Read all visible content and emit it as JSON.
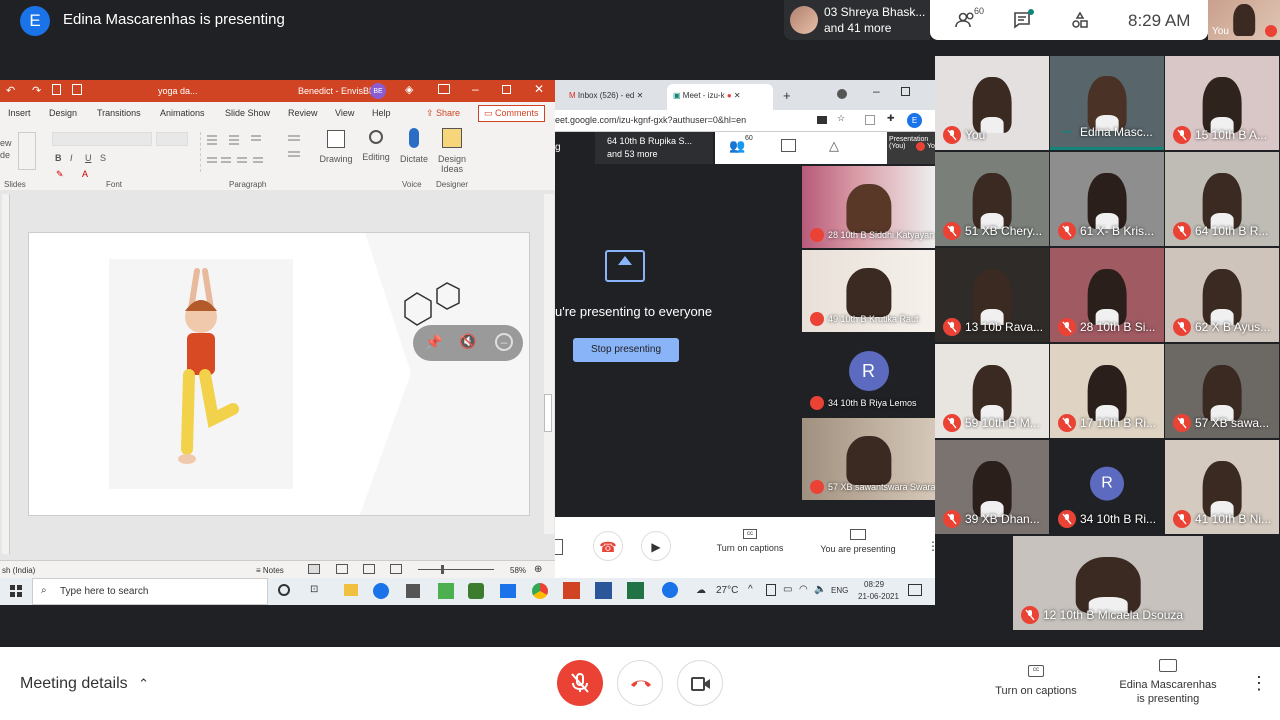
{
  "topbar": {
    "avatar_letter": "E",
    "presenting_title": "Edina Mascarenhas is presenting",
    "people_line1": "03 Shreya Bhask...",
    "people_line2": "and 41 more",
    "people_count": "60",
    "time": "8:29 AM",
    "you_label": "You"
  },
  "ppt": {
    "file_title": "yoga da...",
    "user": "Benedict - EnvisBE",
    "user_initials": "BE",
    "tabs": [
      "Insert",
      "Design",
      "Transitions",
      "Animations",
      "Slide Show",
      "Review",
      "View",
      "Help"
    ],
    "share": "Share",
    "comments": "Comments",
    "groups": [
      "Slides",
      "Font",
      "Paragraph",
      "Voice",
      "Designer"
    ],
    "buttons": {
      "drawing": "Drawing",
      "editing": "Editing",
      "dictate": "Dictate",
      "design_ideas_1": "Design",
      "design_ideas_2": "Ideas",
      "new_label": "ew",
      "de_label": "de"
    },
    "status_lang": "sh (India)",
    "notes": "Notes",
    "zoom": "58%"
  },
  "chrome": {
    "tab1": "Inbox (526) - ed",
    "tab2": "Meet - izu-k",
    "url": "eet.google.com/izu-kgnf-gxk?authuser=0&hl=en",
    "profile": "E"
  },
  "inner_meet": {
    "chip_line1": "64 10th B Rupika S...",
    "chip_line2": "and 53 more",
    "count": "60",
    "presentation_label": "Presentation",
    "presentation_you": "(You)",
    "you_short": "Yo",
    "presenting_to": "u're presenting to everyone",
    "stop": "Stop presenting",
    "captions": "Turn on captions",
    "you_presenting": "You are presenting",
    "tiles": [
      {
        "name": "28 10th B Siddhi Katyayan"
      },
      {
        "name": "49 10th B Krutika Raut"
      },
      {
        "name": "34 10th B Riya Lemos",
        "letter": "R"
      },
      {
        "name": "57 XB sawantswara Swara"
      }
    ]
  },
  "taskbar": {
    "search": "Type here to search",
    "temp": "27°C",
    "lang": "ENG",
    "time": "08:29",
    "date": "21-06-2021"
  },
  "grid": [
    {
      "name": "You"
    },
    {
      "name": "Edina Masc..."
    },
    {
      "name": "15 10th B A..."
    },
    {
      "name": "51 XB Chery..."
    },
    {
      "name": "61 X- B Kris..."
    },
    {
      "name": "64 10th B R..."
    },
    {
      "name": "13 10b Rava..."
    },
    {
      "name": "28 10th B Si..."
    },
    {
      "name": "62 X B Ayus..."
    },
    {
      "name": "59 10th B M..."
    },
    {
      "name": "17 10th B Ri..."
    },
    {
      "name": "57 XB sawa..."
    },
    {
      "name": "39 XB Dhan..."
    },
    {
      "name": "34 10th B Ri...",
      "letter": "R"
    },
    {
      "name": "41 10th B Ni..."
    },
    {
      "name": "12 10th B Micaela Dsouza"
    }
  ],
  "bottom": {
    "meeting_details": "Meeting details",
    "captions": "Turn on captions",
    "presenter_line1": "Edina Mascarenhas",
    "presenter_line2": "is presenting"
  },
  "colors": {
    "accent": "#1a73e8",
    "danger": "#ea4335",
    "ppt": "#d04423",
    "teal": "#12867a"
  }
}
